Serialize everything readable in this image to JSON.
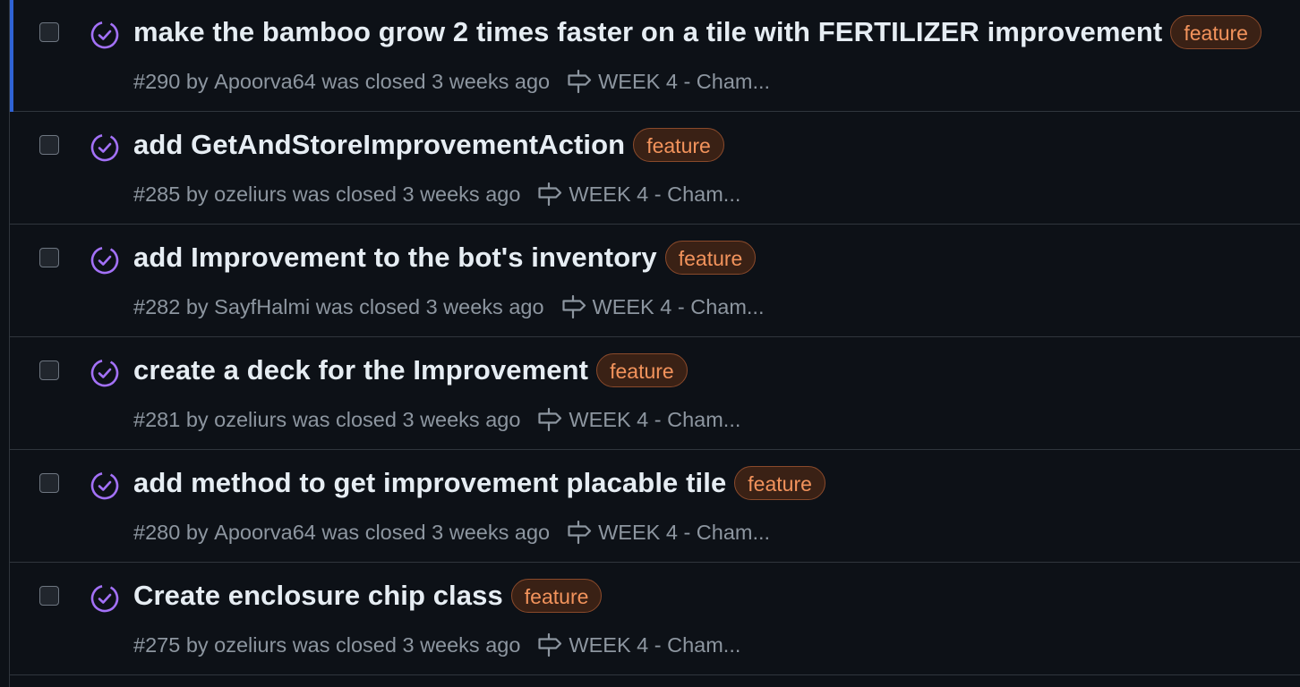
{
  "issues": [
    {
      "title": "make the bamboo grow 2 times faster on a tile with FERTILIZER improvement",
      "label": "feature",
      "number": "#290",
      "by": "by",
      "author": "Apoorva64",
      "status_text": "was closed",
      "time": "3 weeks ago",
      "milestone": "WEEK 4 - Cham...",
      "highlighted": true
    },
    {
      "title": "add GetAndStoreImprovementAction",
      "label": "feature",
      "number": "#285",
      "by": "by",
      "author": "ozeliurs",
      "status_text": "was closed",
      "time": "3 weeks ago",
      "milestone": "WEEK 4 - Cham..."
    },
    {
      "title": "add Improvement to the bot's inventory",
      "label": "feature",
      "number": "#282",
      "by": "by",
      "author": "SayfHalmi",
      "status_text": "was closed",
      "time": "3 weeks ago",
      "milestone": "WEEK 4 - Cham..."
    },
    {
      "title": "create a deck for the Improvement",
      "label": "feature",
      "number": "#281",
      "by": "by",
      "author": "ozeliurs",
      "status_text": "was closed",
      "time": "3 weeks ago",
      "milestone": "WEEK 4 - Cham..."
    },
    {
      "title": "add method to get improvement placable tile",
      "label": "feature",
      "number": "#280",
      "by": "by",
      "author": "Apoorva64",
      "status_text": "was closed",
      "time": "3 weeks ago",
      "milestone": "WEEK 4 - Cham..."
    },
    {
      "title": "Create enclosure chip class",
      "label": "feature",
      "number": "#275",
      "by": "by",
      "author": "ozeliurs",
      "status_text": "was closed",
      "time": "3 weeks ago",
      "milestone": "WEEK 4 - Cham..."
    }
  ],
  "colors": {
    "background": "#0d1117",
    "title": "#e6edf3",
    "meta": "#8d96a0",
    "closed_icon": "#a371f7",
    "label_text": "#f2935c",
    "label_bg": "#3a2115",
    "accent": "#2f63d5"
  },
  "icons": {
    "status": "issue-closed-icon",
    "milestone": "milestone-icon",
    "checkbox": "checkbox"
  }
}
